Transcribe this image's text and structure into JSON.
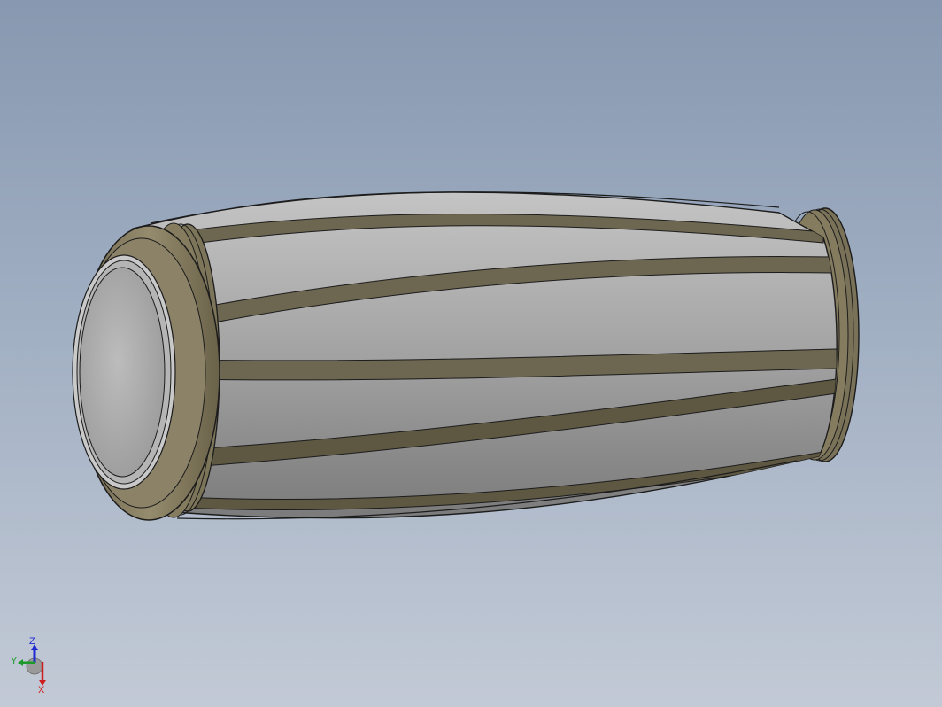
{
  "scene": {
    "model_name": "drum",
    "colors": {
      "background_top": "#8798b0",
      "background_bottom": "#c3cad6",
      "body": "#a8a8a8",
      "band": "#6d6650",
      "rim": "#857c60",
      "face": "#b0b0b0",
      "outline": "#1c1c1c"
    }
  },
  "triad": {
    "z_label": "Z",
    "y_label": "Y",
    "x_label": "X",
    "colors": {
      "z": "#1f2bd0",
      "y": "#1c9a2a",
      "x": "#cc1f1f"
    }
  }
}
